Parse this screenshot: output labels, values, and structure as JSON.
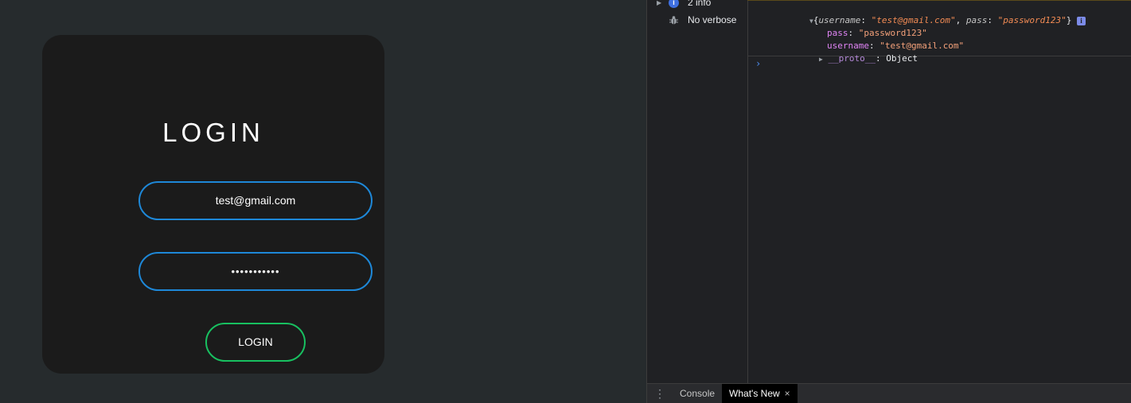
{
  "login": {
    "title": "LOGIN",
    "email_value": "test@gmail.com",
    "password_dots": "•••••••••••",
    "button_label": "LOGIN"
  },
  "devtools": {
    "sidebar": [
      {
        "label": "2 info",
        "icon": "info-icon"
      },
      {
        "label": "No verbose",
        "icon": "bug-icon"
      }
    ],
    "console": {
      "summary": {
        "key1": "username",
        "val1": "\"test@gmail.com\"",
        "key2": "pass",
        "val2": "\"password123\"",
        "badge": "i"
      },
      "props": [
        {
          "key": "pass",
          "value": "\"password123\""
        },
        {
          "key": "username",
          "value": "\"test@gmail.com\""
        }
      ],
      "proto": {
        "key": "__proto__",
        "value": "Object"
      },
      "prompt": "›"
    },
    "bottom_tabs": [
      {
        "label": "Console"
      },
      {
        "label": "What's New"
      }
    ],
    "menu_glyph": "⋮",
    "close_glyph": "×"
  },
  "colors": {
    "page_bg": "#262b2d",
    "card_bg": "#1b1b1b",
    "input_border": "#1e88d8",
    "button_border": "#18c060",
    "devtools_bg": "#202124"
  }
}
